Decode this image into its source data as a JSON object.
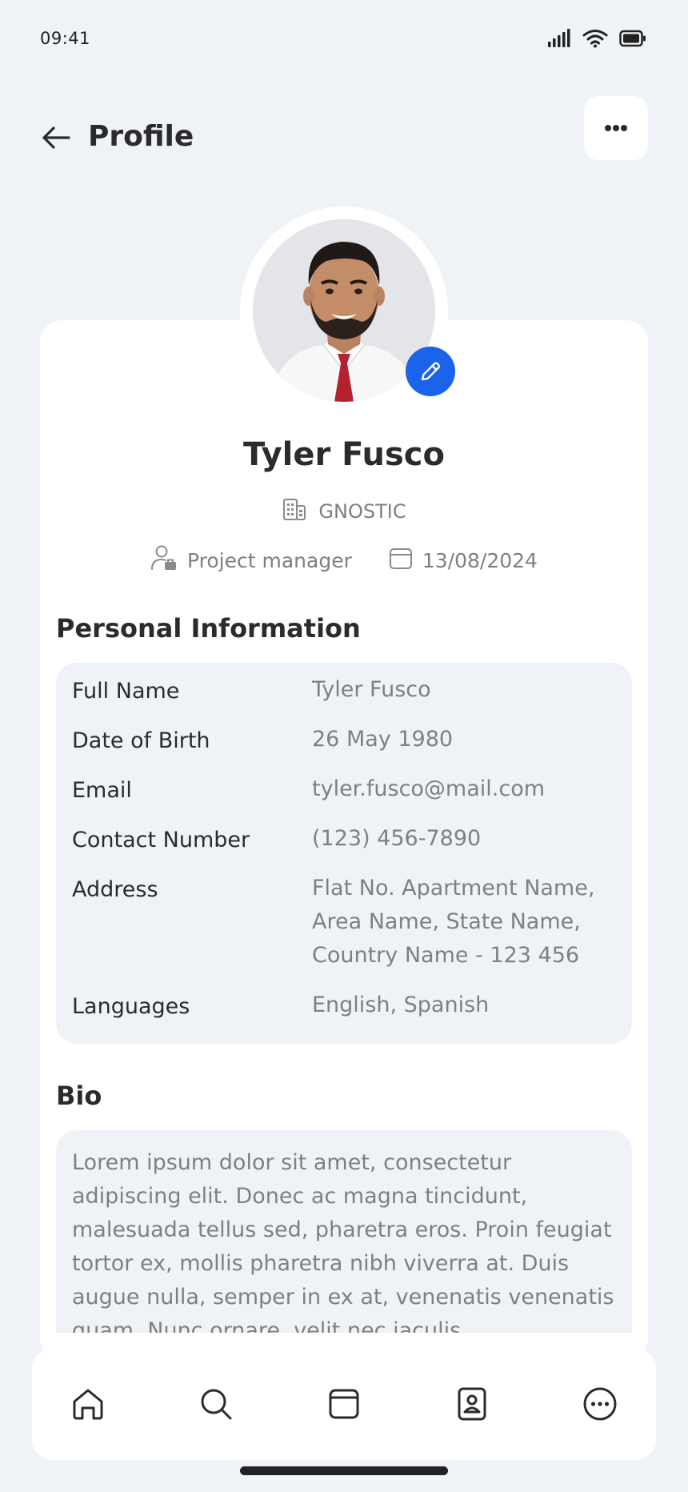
{
  "status": {
    "time": "09:41"
  },
  "header": {
    "title": "Profile"
  },
  "profile": {
    "name": "Tyler Fusco",
    "company": "GNOSTIC",
    "role": "Project manager",
    "date": "13/08/2024"
  },
  "personal_info": {
    "title": "Personal Information",
    "rows": [
      {
        "label": "Full Name",
        "value": "Tyler Fusco"
      },
      {
        "label": "Date of Birth",
        "value": "26 May 1980"
      },
      {
        "label": "Email",
        "value": "tyler.fusco@mail.com"
      },
      {
        "label": "Contact Number",
        "value": "(123) 456-7890"
      },
      {
        "label": "Address",
        "value": "Flat No. Apartment Name, Area Name, State Name, Country Name - 123 456"
      },
      {
        "label": "Languages",
        "value": "English, Spanish"
      }
    ]
  },
  "bio": {
    "title": "Bio",
    "text": "Lorem ipsum dolor sit amet, consectetur adipiscing elit. Donec ac magna tincidunt, malesuada tellus sed, pharetra eros. Proin feugiat tortor ex, mollis pharetra nibh viverra at. Duis augue nulla, semper in ex at, venenatis venenatis quam. Nunc ornare, velit nec iaculis"
  },
  "nav": {
    "items": [
      {
        "icon": "home-icon"
      },
      {
        "icon": "search-icon"
      },
      {
        "icon": "calendar-icon"
      },
      {
        "icon": "contact-book-icon"
      },
      {
        "icon": "more-options-icon"
      }
    ]
  },
  "colors": {
    "background": "#eff2f7",
    "accent": "#1a63ea",
    "card": "#ffffff",
    "text_primary": "#2b2b2b",
    "text_secondary": "#808080"
  }
}
